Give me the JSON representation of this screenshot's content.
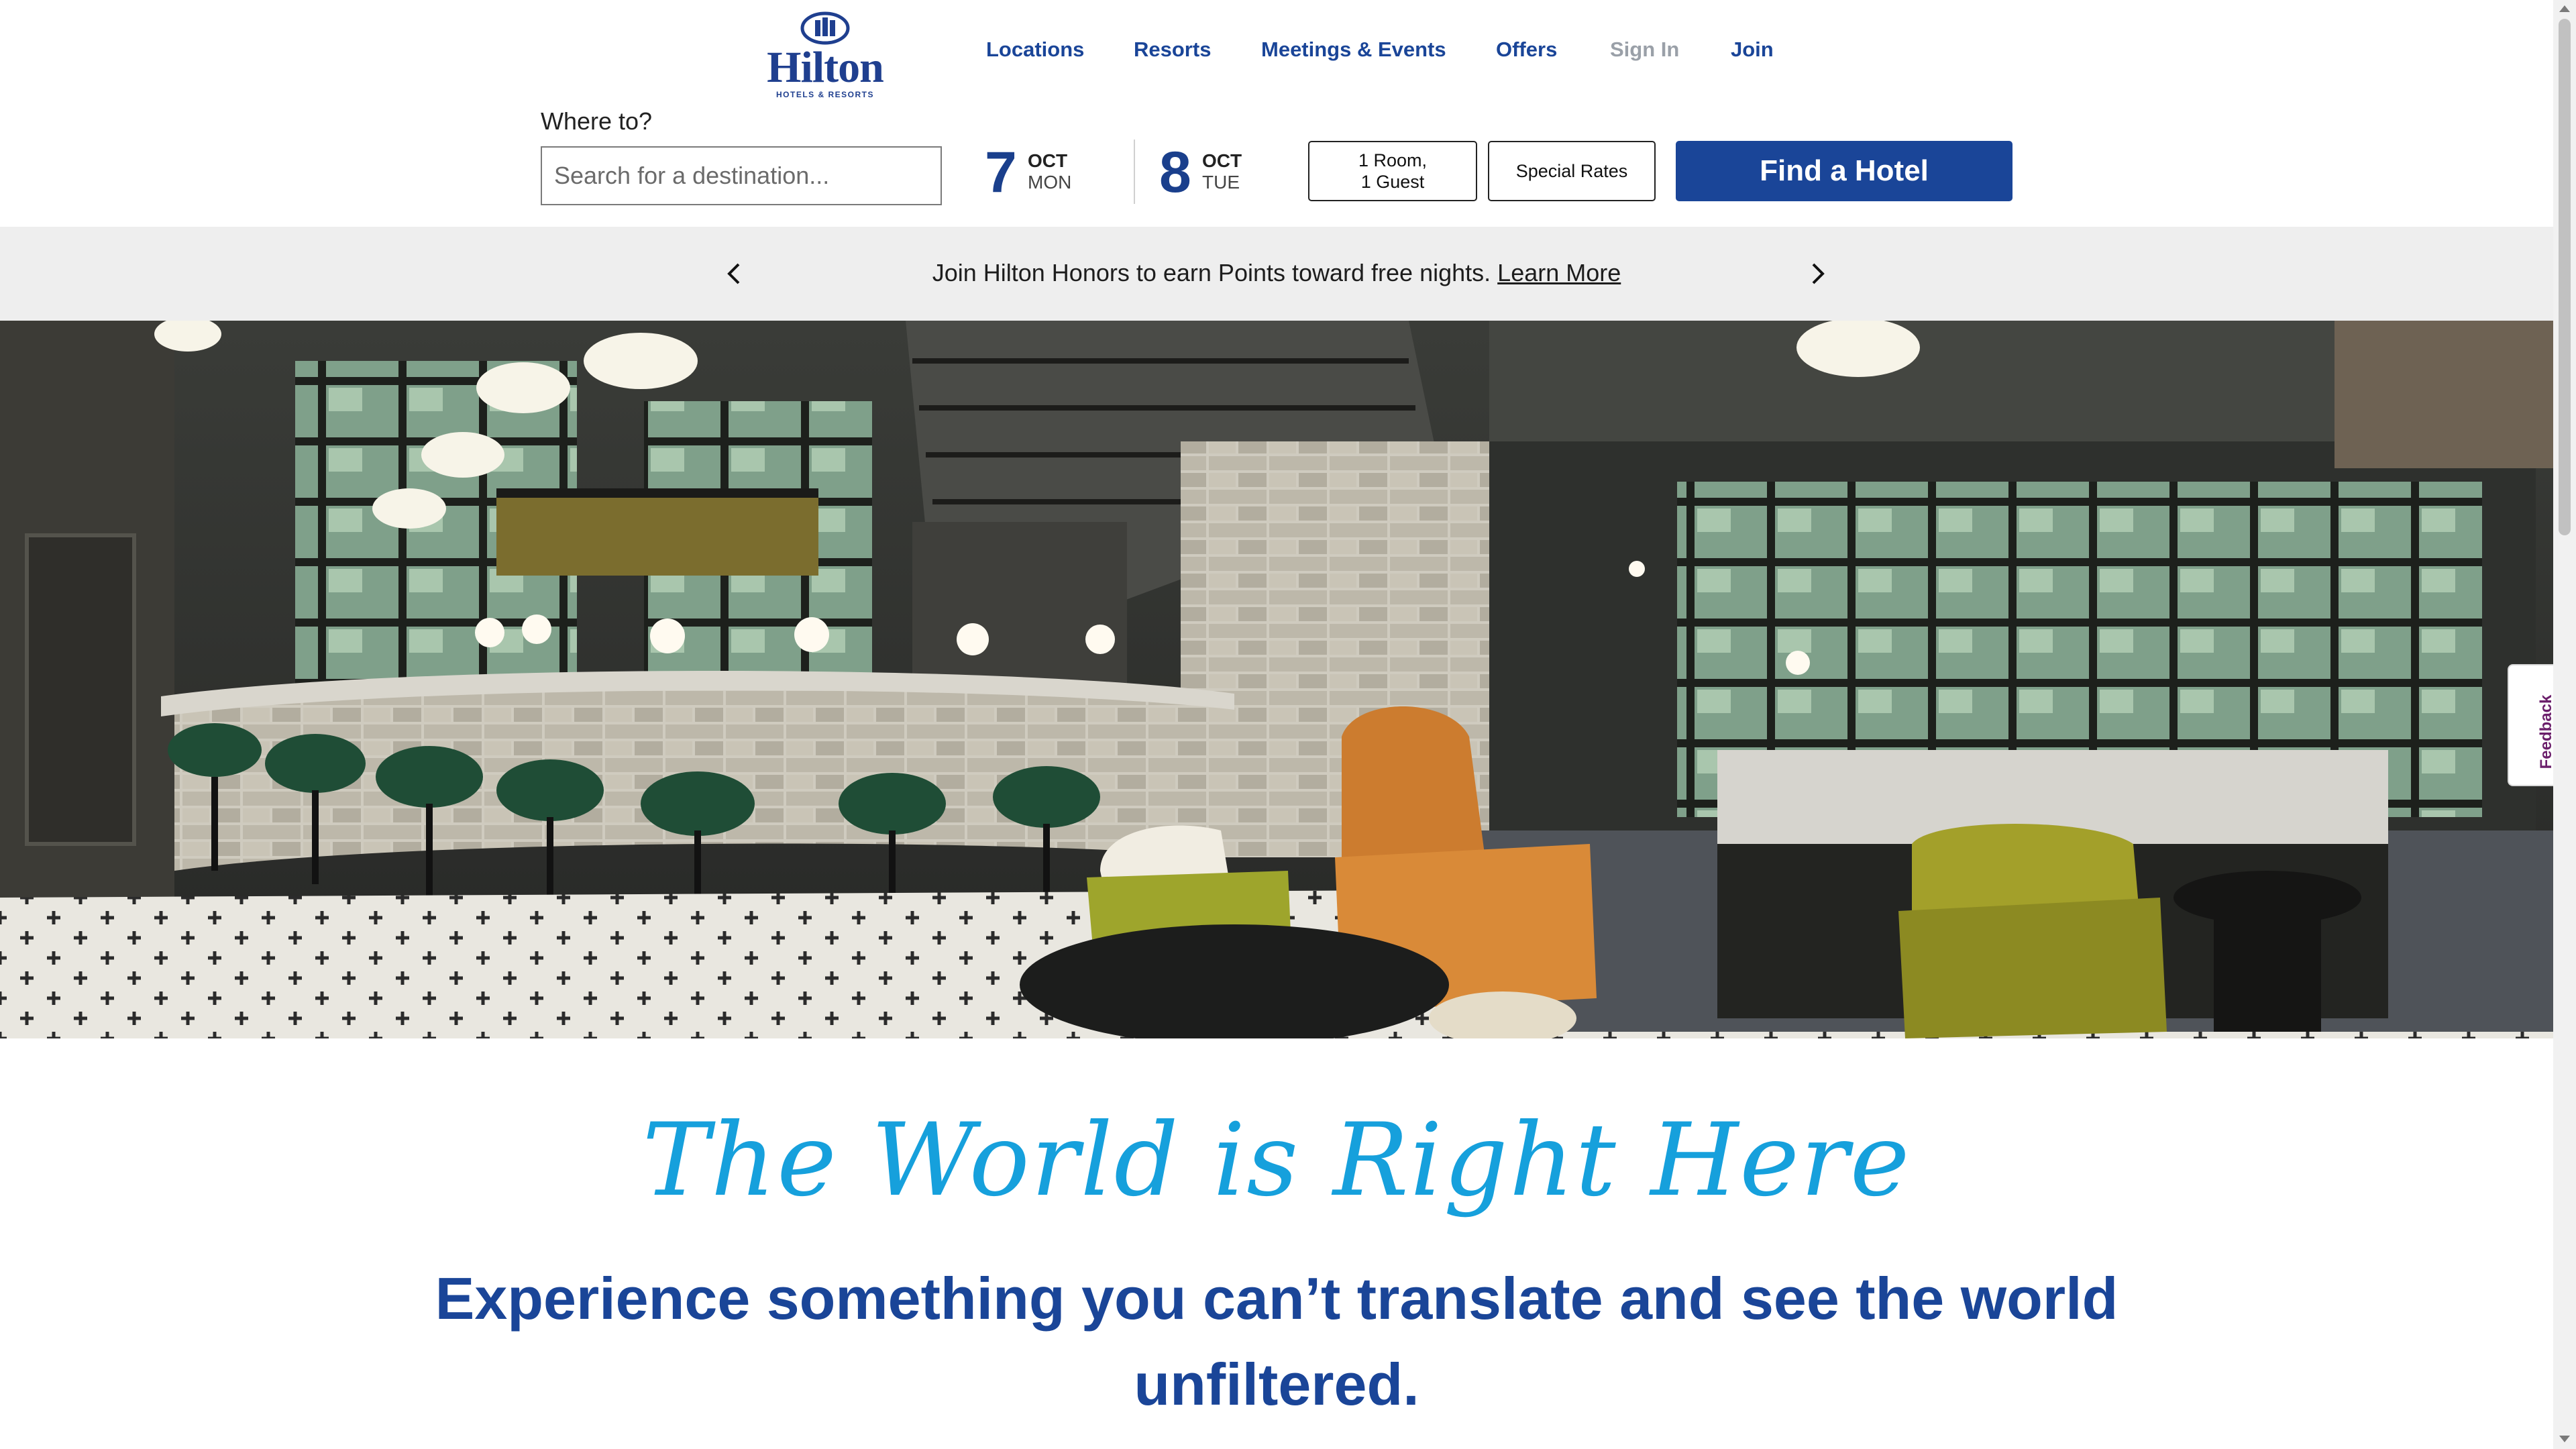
{
  "brand": {
    "name": "Hilton",
    "sub": "HOTELS & RESORTS",
    "primary_color": "#1a4598",
    "accent_color": "#16a0dc"
  },
  "nav": {
    "items": [
      {
        "label": "Locations"
      },
      {
        "label": "Resorts"
      },
      {
        "label": "Meetings & Events"
      },
      {
        "label": "Offers"
      },
      {
        "label": "Sign In"
      },
      {
        "label": "Join"
      }
    ]
  },
  "search": {
    "label": "Where to?",
    "placeholder": "Search for a destination..."
  },
  "dates": {
    "check_in": {
      "day": "7",
      "month": "OCT",
      "weekday": "MON"
    },
    "check_out": {
      "day": "8",
      "month": "OCT",
      "weekday": "TUE"
    }
  },
  "buttons": {
    "rooms_line1": "1 Room,",
    "rooms_line2": "1 Guest",
    "special_rates": "Special Rates",
    "find_hotel": "Find a Hotel"
  },
  "banner": {
    "text": "Join Hilton Honors to earn Points toward free nights.",
    "link": "Learn More",
    "prev_icon": "chevron-left-icon",
    "next_icon": "chevron-right-icon"
  },
  "feedback": {
    "label": "Feedback"
  },
  "content": {
    "tagline": "The World is Right Here",
    "subhead": "Experience something you can’t translate and see the world unfiltered."
  }
}
